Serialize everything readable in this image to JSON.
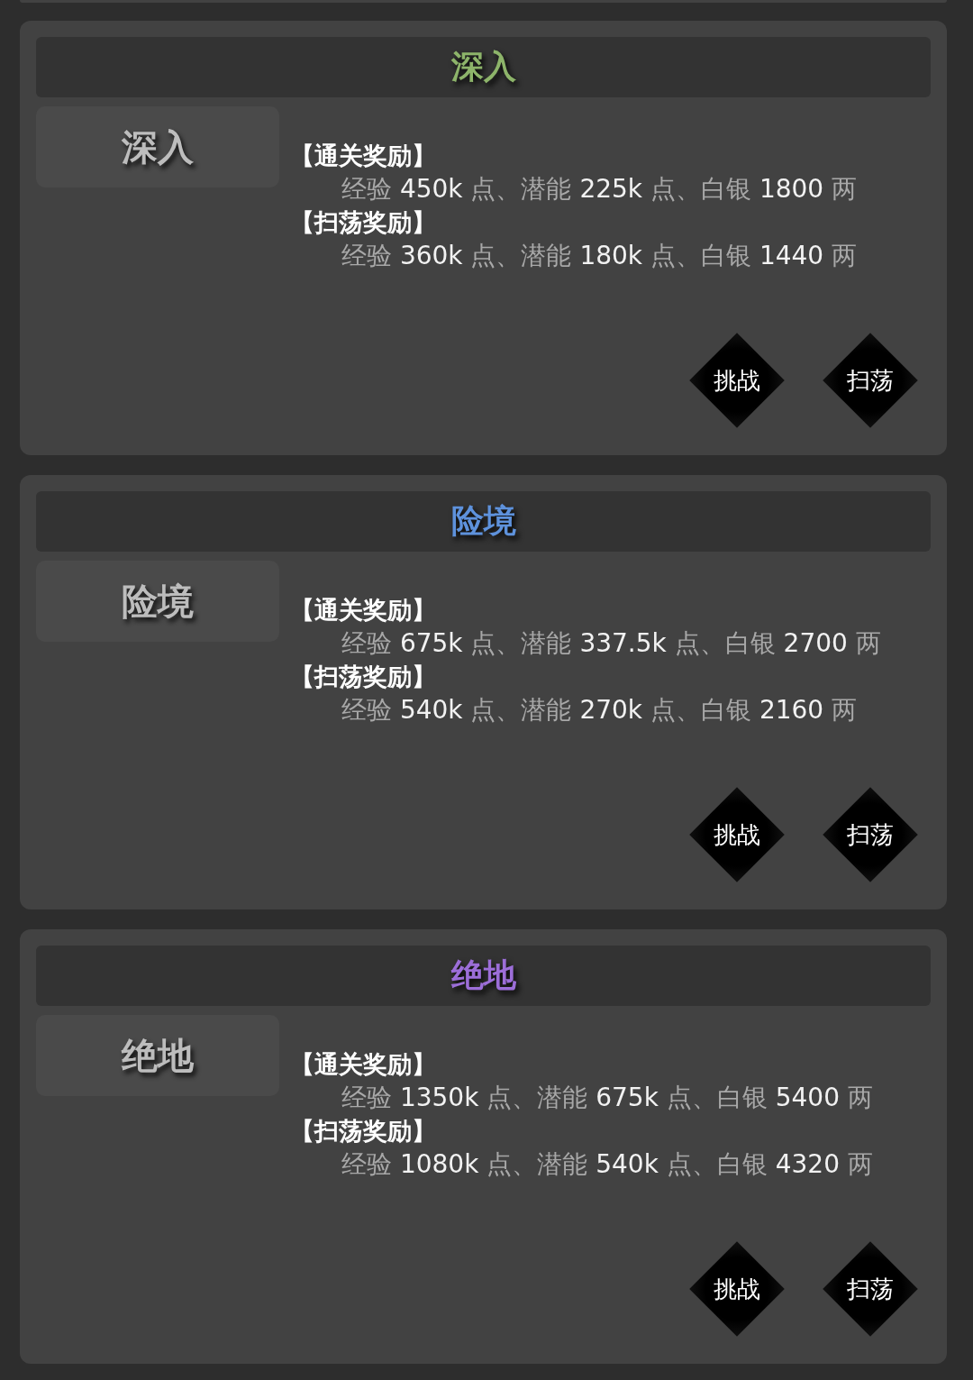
{
  "sections": [
    {
      "title": "深入",
      "color": "#8db46a",
      "tab": "深入",
      "rewards": [
        {
          "heading": "【通关奖励】",
          "segments": [
            {
              "kind": "label",
              "text": "经验 "
            },
            {
              "kind": "value",
              "text": "450k"
            },
            {
              "kind": "label",
              "text": " 点、潜能 "
            },
            {
              "kind": "value",
              "text": "225k"
            },
            {
              "kind": "label",
              "text": " 点、白银 "
            },
            {
              "kind": "value",
              "text": "1800"
            },
            {
              "kind": "label",
              "text": " 两"
            }
          ]
        },
        {
          "heading": "【扫荡奖励】",
          "segments": [
            {
              "kind": "label",
              "text": "经验 "
            },
            {
              "kind": "value",
              "text": "360k"
            },
            {
              "kind": "label",
              "text": " 点、潜能 "
            },
            {
              "kind": "value",
              "text": "180k"
            },
            {
              "kind": "label",
              "text": " 点、白银 "
            },
            {
              "kind": "value",
              "text": "1440"
            },
            {
              "kind": "label",
              "text": " 两"
            }
          ]
        }
      ],
      "buttons": [
        "挑战",
        "扫荡"
      ]
    },
    {
      "title": "险境",
      "color": "#5e92dc",
      "tab": "险境",
      "rewards": [
        {
          "heading": "【通关奖励】",
          "segments": [
            {
              "kind": "label",
              "text": "经验 "
            },
            {
              "kind": "value",
              "text": "675k"
            },
            {
              "kind": "label",
              "text": " 点、潜能 "
            },
            {
              "kind": "value",
              "text": "337.5k"
            },
            {
              "kind": "label",
              "text": " 点、白银 "
            },
            {
              "kind": "value",
              "text": "2700"
            },
            {
              "kind": "label",
              "text": " 两"
            }
          ]
        },
        {
          "heading": "【扫荡奖励】",
          "segments": [
            {
              "kind": "label",
              "text": "经验 "
            },
            {
              "kind": "value",
              "text": "540k"
            },
            {
              "kind": "label",
              "text": " 点、潜能 "
            },
            {
              "kind": "value",
              "text": "270k"
            },
            {
              "kind": "label",
              "text": " 点、白银 "
            },
            {
              "kind": "value",
              "text": "2160"
            },
            {
              "kind": "label",
              "text": " 两"
            }
          ]
        }
      ],
      "buttons": [
        "挑战",
        "扫荡"
      ]
    },
    {
      "title": "绝地",
      "color": "#9c6ed8",
      "tab": "绝地",
      "rewards": [
        {
          "heading": "【通关奖励】",
          "segments": [
            {
              "kind": "label",
              "text": "经验 "
            },
            {
              "kind": "value",
              "text": "1350k"
            },
            {
              "kind": "label",
              "text": " 点、潜能 "
            },
            {
              "kind": "value",
              "text": "675k"
            },
            {
              "kind": "label",
              "text": " 点、白银 "
            },
            {
              "kind": "value",
              "text": "5400"
            },
            {
              "kind": "label",
              "text": " 两"
            }
          ]
        },
        {
          "heading": "【扫荡奖励】",
          "segments": [
            {
              "kind": "label",
              "text": "经验 "
            },
            {
              "kind": "value",
              "text": "1080k"
            },
            {
              "kind": "label",
              "text": " 点、潜能 "
            },
            {
              "kind": "value",
              "text": "540k"
            },
            {
              "kind": "label",
              "text": " 点、白银 "
            },
            {
              "kind": "value",
              "text": "4320"
            },
            {
              "kind": "label",
              "text": " 两"
            }
          ]
        }
      ],
      "buttons": [
        "挑战",
        "扫荡"
      ]
    }
  ]
}
